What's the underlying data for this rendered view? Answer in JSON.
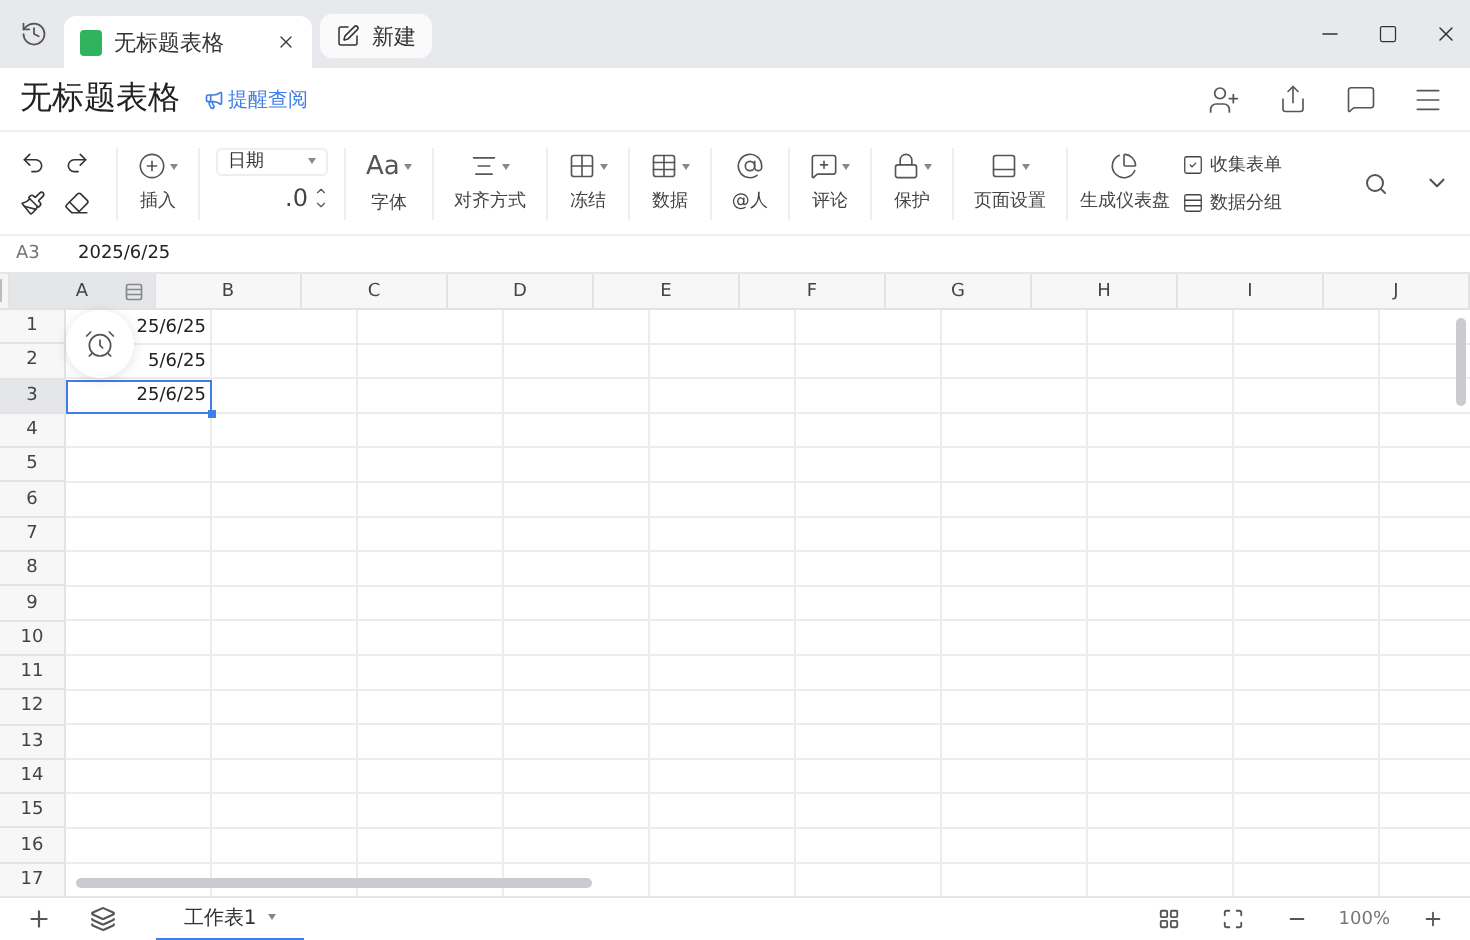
{
  "tabs": [
    {
      "label": "无标题表格",
      "selected": true
    },
    {
      "label": "新建",
      "selected": false
    }
  ],
  "doc": {
    "title": "无标题表格",
    "remind_link": "提醒查阅"
  },
  "toolbar": {
    "format_dropdown": "日期",
    "decimal": ".0",
    "tools": [
      {
        "label": "插入",
        "dropdown": true
      },
      {
        "label": "字体",
        "dropdown": true,
        "glyph": "Aa"
      },
      {
        "label": "对齐方式",
        "dropdown": true
      },
      {
        "label": "冻结",
        "dropdown": true
      },
      {
        "label": "数据",
        "dropdown": true
      },
      {
        "label": "@人",
        "dropdown": false
      },
      {
        "label": "评论",
        "dropdown": true
      },
      {
        "label": "保护",
        "dropdown": true
      },
      {
        "label": "页面设置",
        "dropdown": true
      },
      {
        "label": "生成仪表盘",
        "dropdown": false
      }
    ],
    "quick": [
      "收集表单",
      "数据分组"
    ]
  },
  "formula_bar": {
    "cell_ref": "A3",
    "value": "2025/6/25"
  },
  "columns": [
    {
      "label": "A",
      "selected": true
    },
    {
      "label": "B",
      "selected": false
    },
    {
      "label": "C",
      "selected": false
    },
    {
      "label": "D",
      "selected": false
    },
    {
      "label": "E",
      "selected": false
    },
    {
      "label": "F",
      "selected": false
    },
    {
      "label": "G",
      "selected": false
    },
    {
      "label": "H",
      "selected": false
    },
    {
      "label": "I",
      "selected": false
    },
    {
      "label": "J",
      "selected": false
    }
  ],
  "rows": [
    {
      "number": "1",
      "cells": [
        "25/6/25"
      ],
      "selected": false
    },
    {
      "number": "2",
      "cells": [
        "5/6/25"
      ],
      "selected": false
    },
    {
      "number": "3",
      "cells": [
        "25/6/25"
      ],
      "selected": true
    },
    {
      "number": "4",
      "cells": [],
      "selected": false
    },
    {
      "number": "5",
      "cells": [],
      "selected": false
    },
    {
      "number": "6",
      "cells": [],
      "selected": false
    },
    {
      "number": "7",
      "cells": [],
      "selected": false
    },
    {
      "number": "8",
      "cells": [],
      "selected": false
    },
    {
      "number": "9",
      "cells": [],
      "selected": false
    },
    {
      "number": "10",
      "cells": [],
      "selected": false
    },
    {
      "number": "11",
      "cells": [],
      "selected": false
    },
    {
      "number": "12",
      "cells": [],
      "selected": false
    },
    {
      "number": "13",
      "cells": [],
      "selected": false
    },
    {
      "number": "14",
      "cells": [],
      "selected": false
    },
    {
      "number": "15",
      "cells": [],
      "selected": false
    },
    {
      "number": "16",
      "cells": [],
      "selected": false
    },
    {
      "number": "17",
      "cells": [],
      "selected": false
    }
  ],
  "sheet_tabs": [
    {
      "label": "工作表1",
      "selected": true
    }
  ],
  "zoom": "100%"
}
